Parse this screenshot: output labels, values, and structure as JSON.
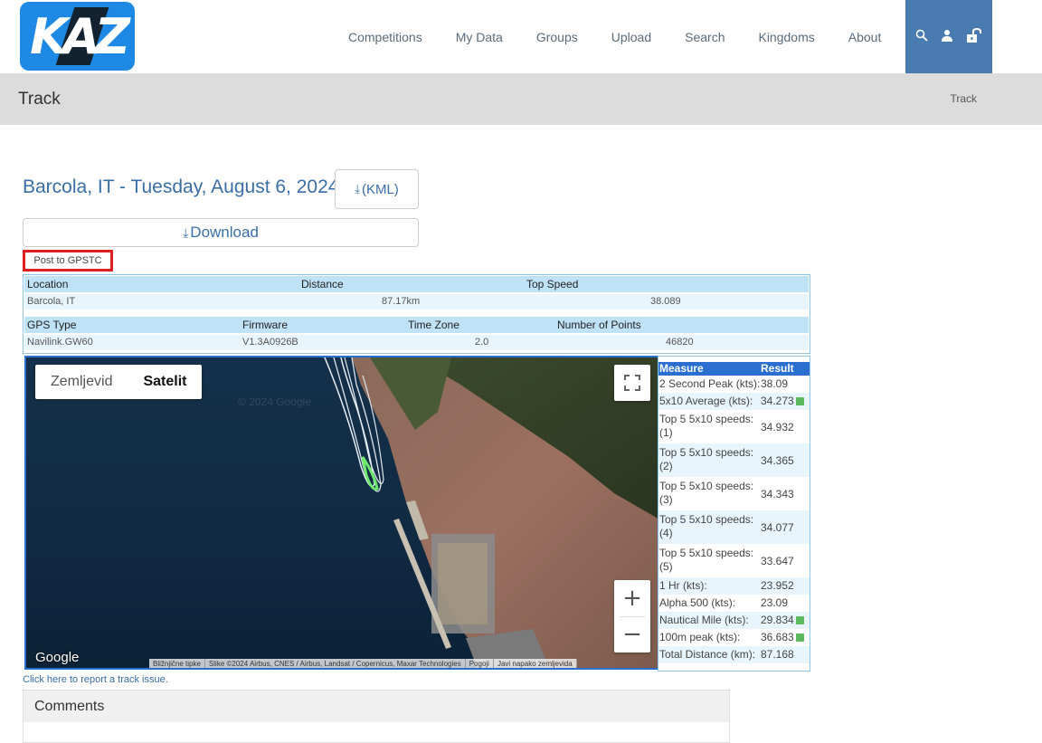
{
  "header": {
    "logo_text": "KAZ",
    "nav": [
      "Competitions",
      "My Data",
      "Groups",
      "Upload",
      "Search",
      "Kingdoms",
      "About"
    ],
    "icons": [
      "search-icon",
      "user-icon",
      "unlock-icon"
    ]
  },
  "pagebar": {
    "title": "Track",
    "breadcrumb": "Track"
  },
  "track": {
    "title": "Barcola, IT - Tuesday, August 6, 2024",
    "kml_label": "(KML)",
    "download_label": "Download",
    "post_label": "Post to GPSTC"
  },
  "info": {
    "row1_headers": [
      "Location",
      "Distance",
      "Top Speed"
    ],
    "row1_values": [
      "Barcola, IT",
      "87.17km",
      "38.089"
    ],
    "row2_headers": [
      "GPS Type",
      "Firmware",
      "Time Zone",
      "Number of Points"
    ],
    "row2_values": [
      "Navilink.GW60",
      "V1.3A0926B",
      "2.0",
      "46820"
    ]
  },
  "map": {
    "type_map": "Zemljevid",
    "type_satellite": "Satelit",
    "selected_type": "Satelit",
    "google": "Google",
    "watermark": "© 2024 Google",
    "attribution": [
      "Bližnjične tipke",
      "Slike ©2024 Airbus, CNES / Airbus, Landsat / Copernicus, Maxar Technologies",
      "Pogoji",
      "Javi napako zemljevida"
    ]
  },
  "results": {
    "headers": [
      "Measure",
      "Result"
    ],
    "rows": [
      {
        "measure": "2 Second Peak (kts):",
        "result": "38.09",
        "cal": false
      },
      {
        "measure": "5x10 Average (kts):",
        "result": "34.273",
        "cal": true
      },
      {
        "measure": "Top 5 5x10 speeds: (1)",
        "result": "34.932",
        "cal": false
      },
      {
        "measure": "Top 5 5x10 speeds: (2)",
        "result": "34.365",
        "cal": false
      },
      {
        "measure": "Top 5 5x10 speeds: (3)",
        "result": "34.343",
        "cal": false
      },
      {
        "measure": "Top 5 5x10 speeds: (4)",
        "result": "34.077",
        "cal": false
      },
      {
        "measure": "Top 5 5x10 speeds: (5)",
        "result": "33.647",
        "cal": false
      },
      {
        "measure": "1 Hr (kts):",
        "result": "23.952",
        "cal": false
      },
      {
        "measure": "Alpha 500 (kts):",
        "result": "23.09",
        "cal": false
      },
      {
        "measure": "Nautical Mile (kts):",
        "result": "29.834",
        "cal": true
      },
      {
        "measure": "100m peak (kts):",
        "result": "36.683",
        "cal": true
      },
      {
        "measure": "Total Distance (km):",
        "result": "87.168",
        "cal": false
      }
    ]
  },
  "report_link": "Click here to report a track issue.",
  "comments_title": "Comments",
  "colors": {
    "brand_blue": "#1e88e5",
    "link_blue": "#3a6ea5",
    "nav_icons_bg": "#4a7bb0",
    "table_hdr": "#bfe2f7",
    "highlight_red": "#e02020"
  }
}
